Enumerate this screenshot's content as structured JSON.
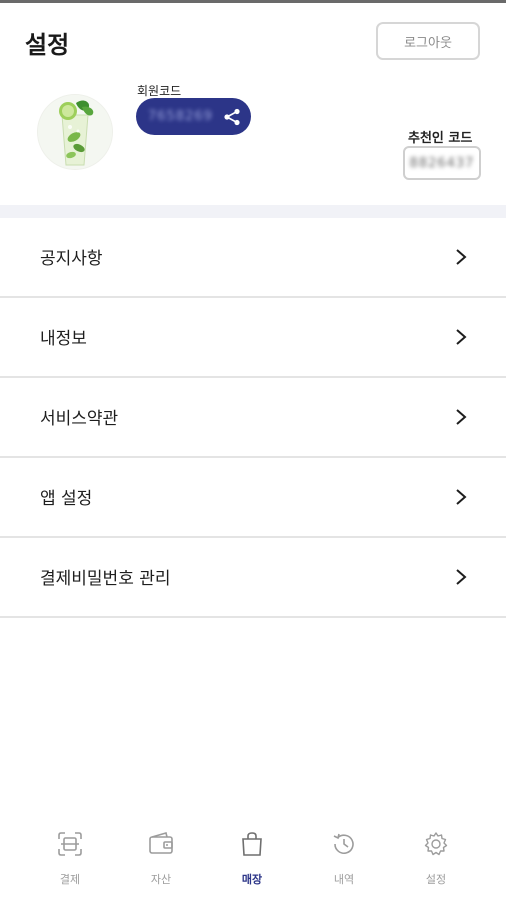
{
  "header": {
    "title": "설정",
    "logout_label": "로그아웃"
  },
  "profile": {
    "member_code_label": "회원코드",
    "member_code_value": "7658269",
    "referrer_label": "추천인 코드",
    "referrer_value": "8826437"
  },
  "menu": {
    "items": [
      {
        "label": "공지사항"
      },
      {
        "label": "내정보"
      },
      {
        "label": "서비스약관"
      },
      {
        "label": "앱 설정"
      },
      {
        "label": "결제비밀번호 관리"
      }
    ]
  },
  "nav": {
    "items": [
      {
        "label": "결제"
      },
      {
        "label": "자산"
      },
      {
        "label": "매장"
      },
      {
        "label": "내역"
      },
      {
        "label": "설정"
      }
    ],
    "active_index": 2
  },
  "colors": {
    "accent": "#2c3588",
    "inactive": "#9c9c9c",
    "divider": "#e4e4e4",
    "band": "#f1f2f7"
  }
}
